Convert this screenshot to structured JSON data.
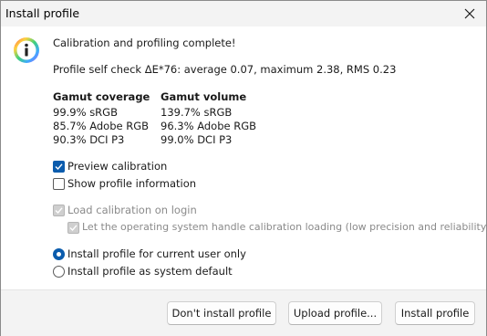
{
  "window": {
    "title": "Install profile"
  },
  "message": {
    "headline": "Calibration and profiling complete!",
    "self_check": "Profile self check ΔE*76: average 0.07, maximum 2.38, RMS 0.23"
  },
  "gamut": {
    "coverage_header": "Gamut coverage",
    "volume_header": "Gamut volume",
    "coverage": [
      "99.9% sRGB",
      "85.7% Adobe RGB",
      "90.3% DCI P3"
    ],
    "volume": [
      "139.7% sRGB",
      "96.3% Adobe RGB",
      "99.0% DCI P3"
    ]
  },
  "options": {
    "preview_calibration": {
      "label": "Preview calibration",
      "checked": true
    },
    "show_profile_information": {
      "label": "Show profile information",
      "checked": false
    },
    "load_calibration_on_login": {
      "label": "Load calibration on login",
      "checked": true,
      "enabled": false
    },
    "os_handle_calibration": {
      "label": "Let the operating system handle calibration loading (low precision and reliability)",
      "checked": true,
      "enabled": false
    }
  },
  "install_scope": {
    "current_user": {
      "label": "Install profile for current user only",
      "selected": true
    },
    "system_default": {
      "label": "Install profile as system default",
      "selected": false
    }
  },
  "buttons": {
    "dont_install": "Don't install profile",
    "upload": "Upload profile...",
    "install": "Install profile"
  },
  "colors": {
    "accent": "#0b5cad",
    "disabled": "#8a8a8a"
  }
}
